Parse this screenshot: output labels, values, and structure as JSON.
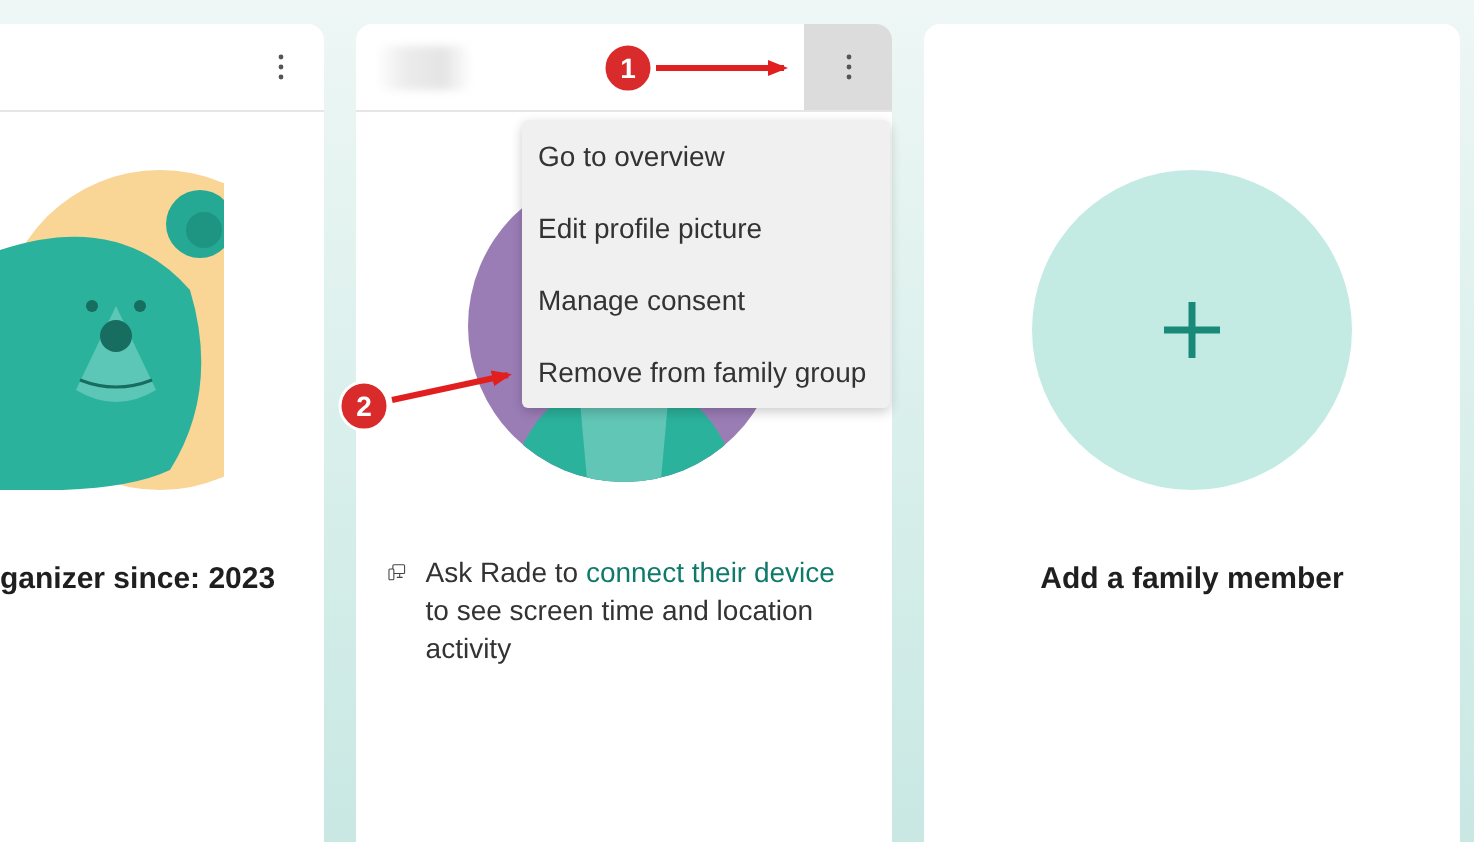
{
  "cards": [
    {
      "kind": "organizer",
      "caption": "ganizer since: 2023"
    },
    {
      "kind": "member",
      "menu_open": true,
      "menu": [
        "Go to overview",
        "Edit profile picture",
        "Manage consent",
        "Remove from family group"
      ],
      "notice": {
        "before": "Ask Rade to ",
        "link": "connect their device",
        "after": " to see screen time and location activity"
      }
    },
    {
      "kind": "add",
      "caption": "Add a family member"
    }
  ],
  "annotations": [
    {
      "label": "1"
    },
    {
      "label": "2"
    }
  ]
}
